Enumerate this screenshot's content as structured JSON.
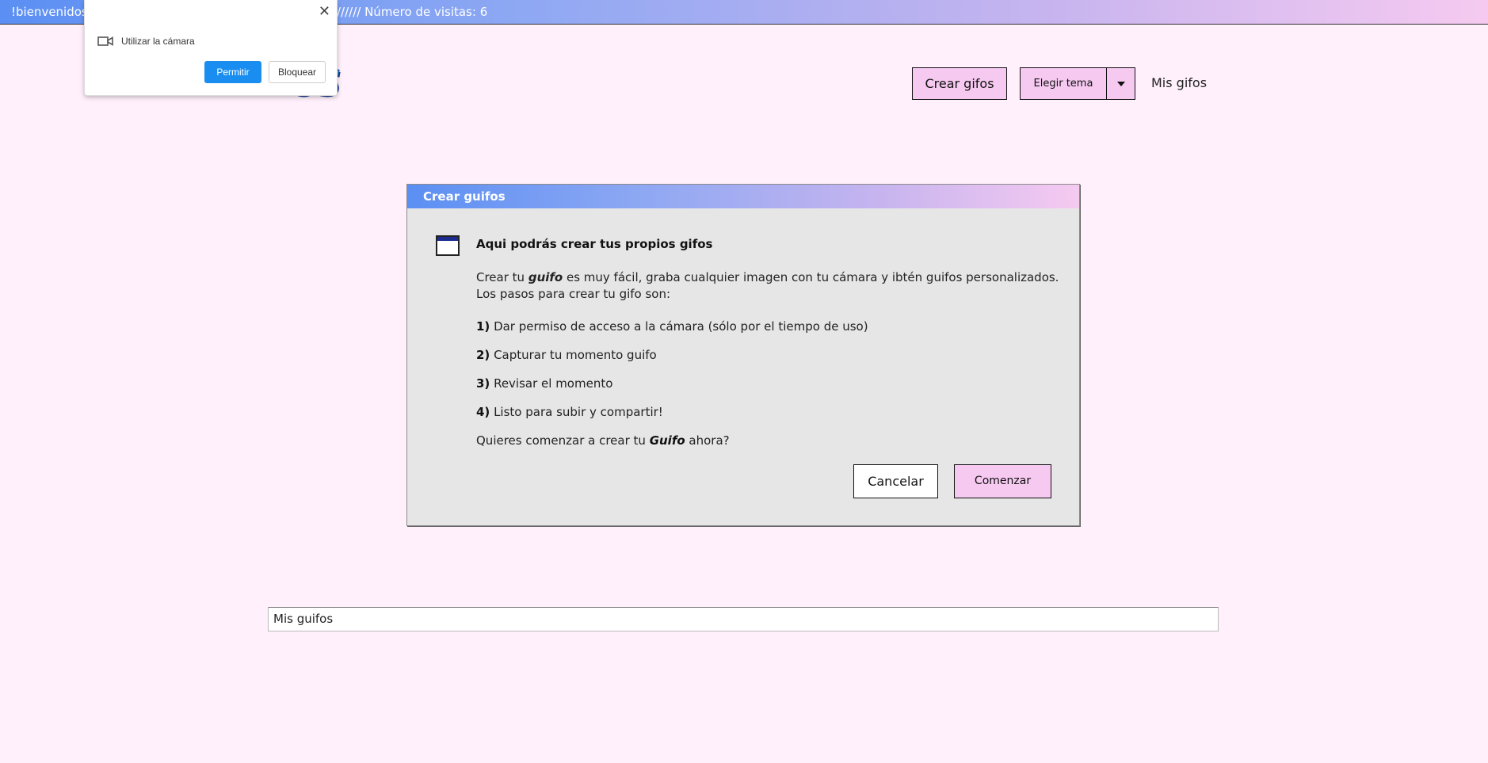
{
  "banner": {
    "left_text": "!bienvenidos",
    "right_text": "////// Número de visitas: 6"
  },
  "logo": {
    "text": "OS"
  },
  "header": {
    "create_label": "Crear gifos",
    "theme_label": "Elegir tema",
    "my_gifs_label": "Mis gifos"
  },
  "modal": {
    "header_title": "Crear guifos",
    "title": "Aqui podrás crear tus propios gifos",
    "desc": {
      "pre": "Crear tu ",
      "em": "guifo",
      "post": " es muy fácil, graba cualquier imagen con tu cámara y ibtén guifos personalizados.",
      "line2": "Los pasos para crear tu gifo son:"
    },
    "steps": [
      {
        "num": "1)",
        "text": " Dar permiso de acceso a la cámara (sólo por el tiempo de uso)"
      },
      {
        "num": "2)",
        "text": " Capturar tu momento guifo"
      },
      {
        "num": "3)",
        "text": " Revisar el momento"
      },
      {
        "num": "4)",
        "text": " Listo para subir y compartir!"
      }
    ],
    "question": {
      "pre": "Quieres comenzar a crear tu ",
      "em": "Guifo",
      "post": " ahora?"
    },
    "cancel_label": "Cancelar",
    "start_label": "Comenzar"
  },
  "my_gifs_bar": {
    "label": "Mis guifos"
  },
  "permission": {
    "label": "Utilizar la cámara",
    "allow_label": "Permitir",
    "block_label": "Bloquear",
    "close_glyph": "✕"
  },
  "colors": {
    "background": "#fff0fb",
    "accent_pink": "#f6c9f1",
    "allow_blue": "#1a8ef0",
    "gradient_start": "#5b8ff3",
    "gradient_end": "#f6caf0"
  }
}
